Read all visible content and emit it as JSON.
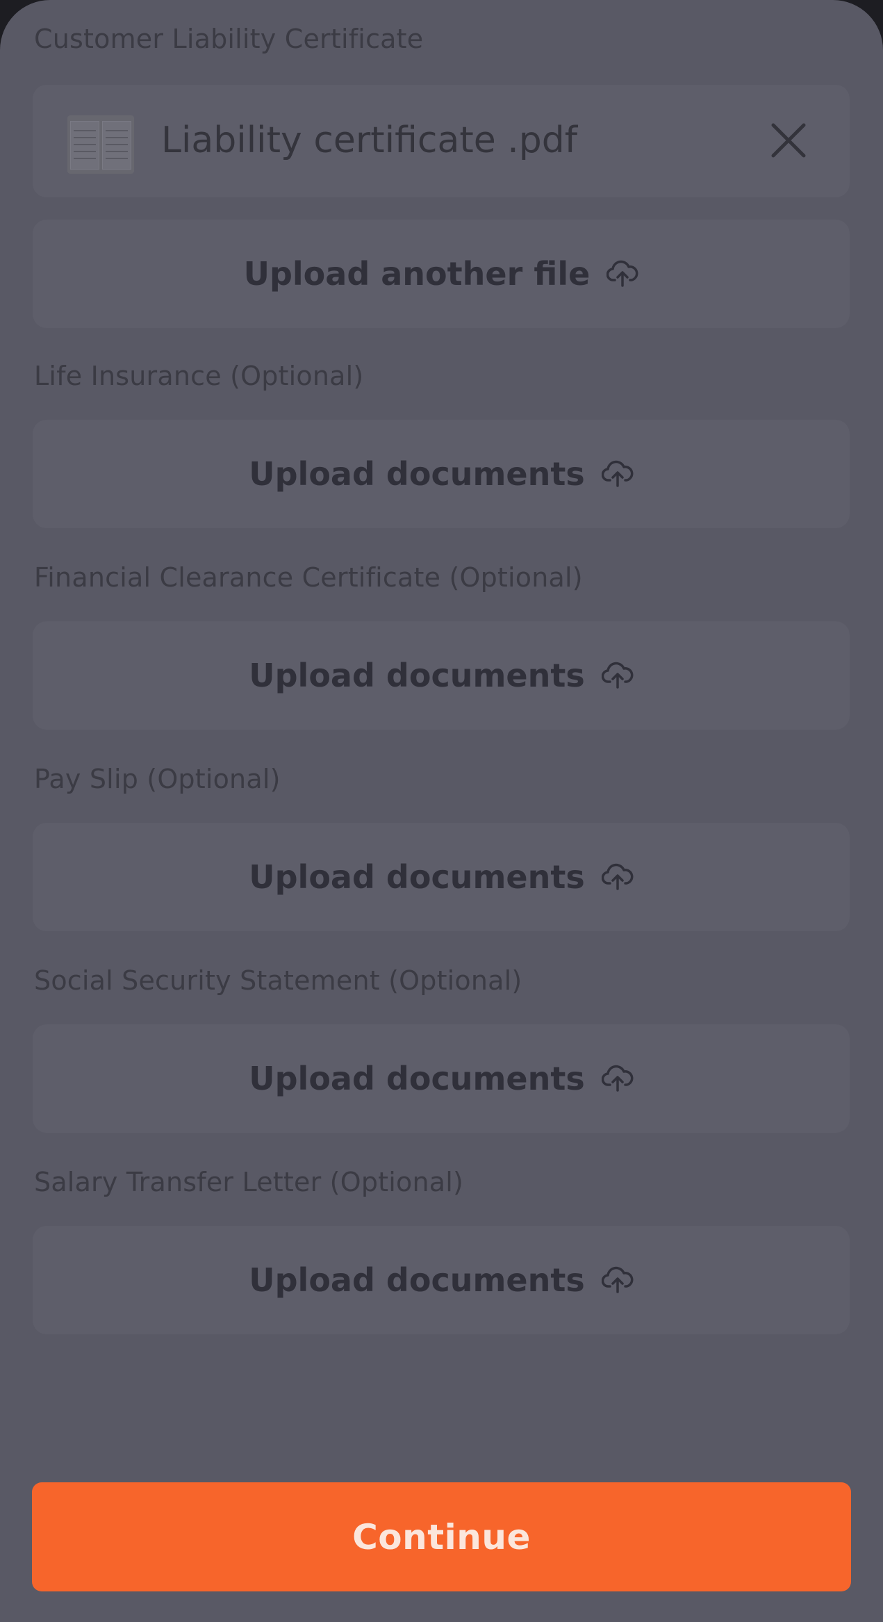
{
  "colors": {
    "sheet_background": "#595965",
    "card_background": "#5e5e6a",
    "primary_button": "#f7652b"
  },
  "sections": {
    "customer_liability": {
      "label": "Customer Liability Certificate",
      "file": {
        "name": "Liability certificate .pdf",
        "thumbnail_icon": "pdf-thumbnail-icon",
        "remove_icon": "close-icon"
      },
      "upload_label": "Upload another file"
    },
    "life_insurance": {
      "label": "Life Insurance (Optional)",
      "upload_label": "Upload documents"
    },
    "financial_clearance": {
      "label": "Financial Clearance Certificate (Optional)",
      "upload_label": "Upload documents"
    },
    "pay_slip": {
      "label": "Pay Slip (Optional)",
      "upload_label": "Upload documents"
    },
    "social_security": {
      "label": "Social Security Statement (Optional)",
      "upload_label": "Upload documents"
    },
    "salary_transfer": {
      "label": "Salary Transfer Letter (Optional)",
      "upload_label": "Upload documents"
    }
  },
  "upload_icon": "cloud-upload-icon",
  "continue_label": "Continue"
}
